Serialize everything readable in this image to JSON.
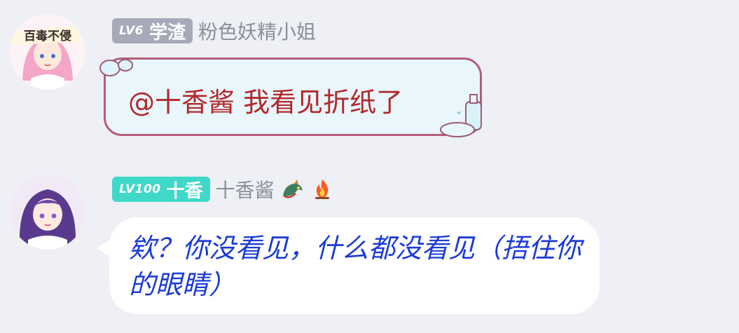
{
  "messages": [
    {
      "level": "LV6",
      "rank": "学渣",
      "nickname": "粉色妖精小姐",
      "avatar_label": "百毒不侵",
      "text": "@十香酱 我看见折纸了",
      "badge_color": "#a6aab8",
      "text_color": "#b2272a"
    },
    {
      "level": "LV100",
      "rank": "十香",
      "nickname": "十香酱",
      "emoji_icons": [
        "dragon-icon",
        "fire-icon"
      ],
      "text": "欸？你没看见，什么都没看见（捂住你的眼睛）",
      "badge_color": "#3fd8c9",
      "text_color": "#1b3bd6"
    }
  ]
}
